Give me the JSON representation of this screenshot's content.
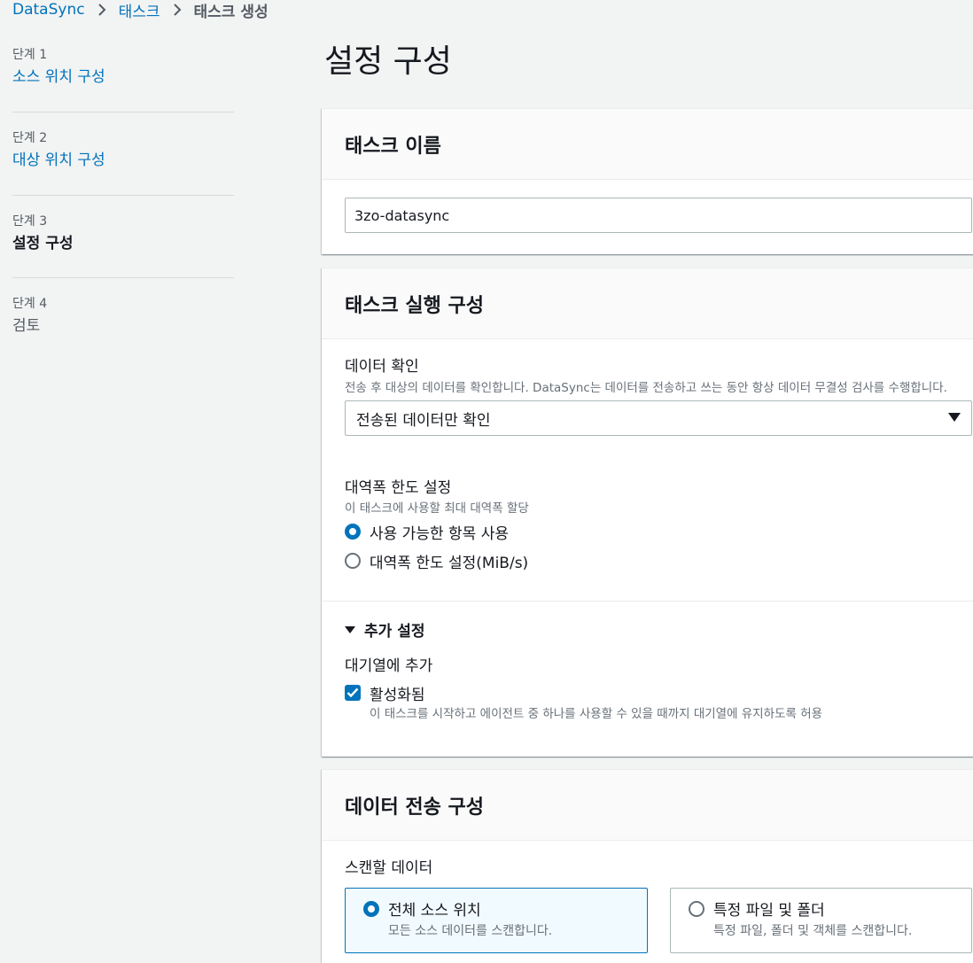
{
  "breadcrumb": {
    "items": [
      "DataSync",
      "태스크"
    ],
    "current": "태스크 생성"
  },
  "steps": [
    {
      "num": "단계 1",
      "label": "소스 위치 구성",
      "state": "link"
    },
    {
      "num": "단계 2",
      "label": "대상 위치 구성",
      "state": "link"
    },
    {
      "num": "단계 3",
      "label": "설정 구성",
      "state": "active"
    },
    {
      "num": "단계 4",
      "label": "검토",
      "state": "disabled"
    }
  ],
  "page_title": "설정 구성",
  "task_name": {
    "header": "태스크 이름",
    "value": "3zo-datasync"
  },
  "execution": {
    "header": "태스크 실행 구성",
    "verify_label": "데이터 확인",
    "verify_desc": "전송 후 대상의 데이터를 확인합니다. DataSync는 데이터를 전송하고 쓰는 동안 항상 데이터 무결성 검사를 수행합니다.",
    "verify_selected": "전송된 데이터만 확인",
    "bandwidth_label": "대역폭 한도 설정",
    "bandwidth_desc": "이 태스크에 사용할 최대 대역폭 할당",
    "bandwidth_options": [
      "사용 가능한 항목 사용",
      "대역폭 한도 설정(MiB/s)"
    ],
    "bandwidth_selected_index": 0,
    "additional_title": "추가 설정",
    "queue_label": "대기열에 추가",
    "queue_checkbox_label": "활성화됨",
    "queue_checked": true,
    "queue_desc": "이 태스크를 시작하고 에이전트 중 하나를 사용할 수 있을 때까지 대기열에 유지하도록 허용"
  },
  "transfer": {
    "header": "데이터 전송 구성",
    "scan_label": "스캔할 데이터",
    "options": [
      {
        "title": "전체 소스 위치",
        "desc": "모든 소스 데이터를 스캔합니다.",
        "selected": true
      },
      {
        "title": "특정 파일 및 폴더",
        "desc": "특정 파일, 폴더 및 객체를 스캔합니다.",
        "selected": false
      }
    ]
  },
  "colors": {
    "link": "#0073bb",
    "text": "#16191f",
    "muted": "#687078",
    "background": "#f2f3f3"
  }
}
